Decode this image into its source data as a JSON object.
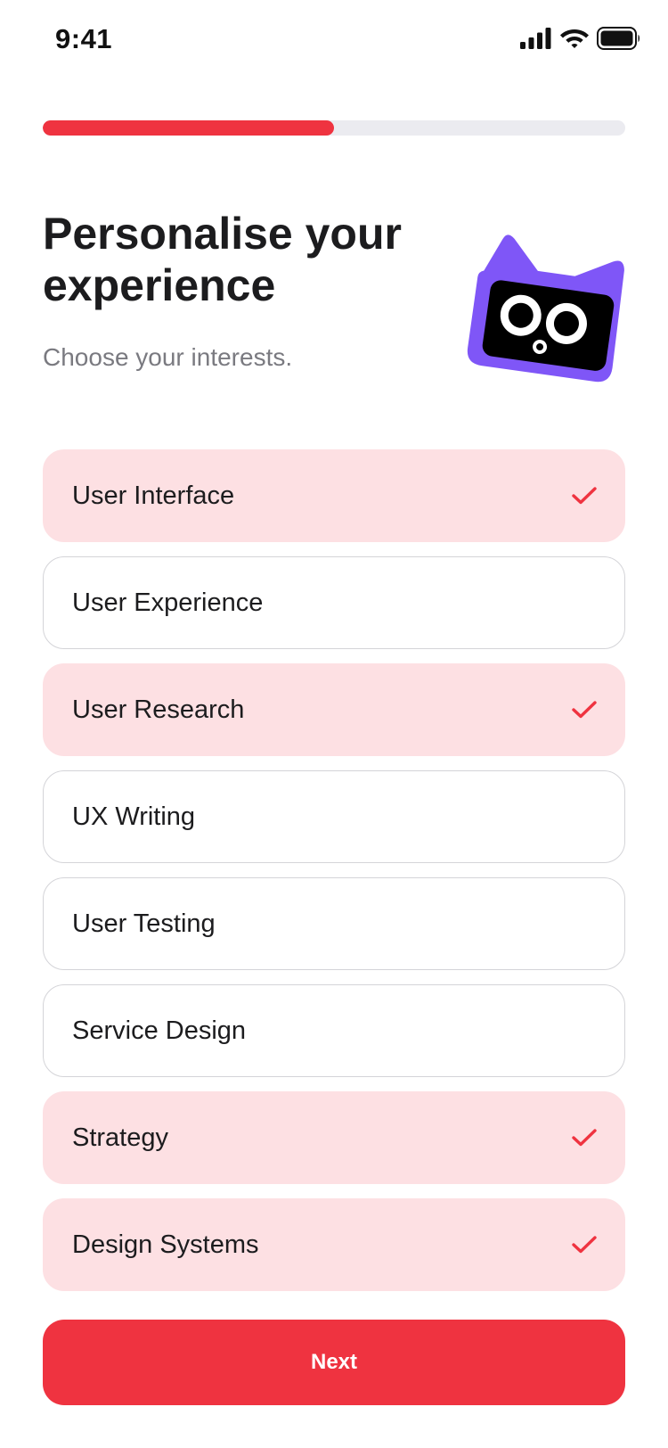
{
  "status_bar": {
    "time": "9:41",
    "icons": [
      "cellular-signal-icon",
      "wifi-icon",
      "battery-icon"
    ]
  },
  "progress": {
    "fraction": 0.5,
    "color": "#ef3340",
    "track_color": "#ebebf0"
  },
  "header": {
    "title": "Personalise your experience",
    "subtitle": "Choose your interests.",
    "mascot_icon": "purple-cat-mascot-icon"
  },
  "options": [
    {
      "label": "User Interface",
      "selected": true
    },
    {
      "label": "User Experience",
      "selected": false
    },
    {
      "label": "User Research",
      "selected": true
    },
    {
      "label": "UX Writing",
      "selected": false
    },
    {
      "label": "User Testing",
      "selected": false
    },
    {
      "label": "Service Design",
      "selected": false
    },
    {
      "label": "Strategy",
      "selected": true
    },
    {
      "label": "Design Systems",
      "selected": true
    }
  ],
  "next_button": {
    "label": "Next"
  },
  "colors": {
    "accent": "#ef3340",
    "selected_background": "#fde0e3",
    "unselected_border": "#d4d4d8",
    "mascot_purple": "#7f56f7"
  }
}
